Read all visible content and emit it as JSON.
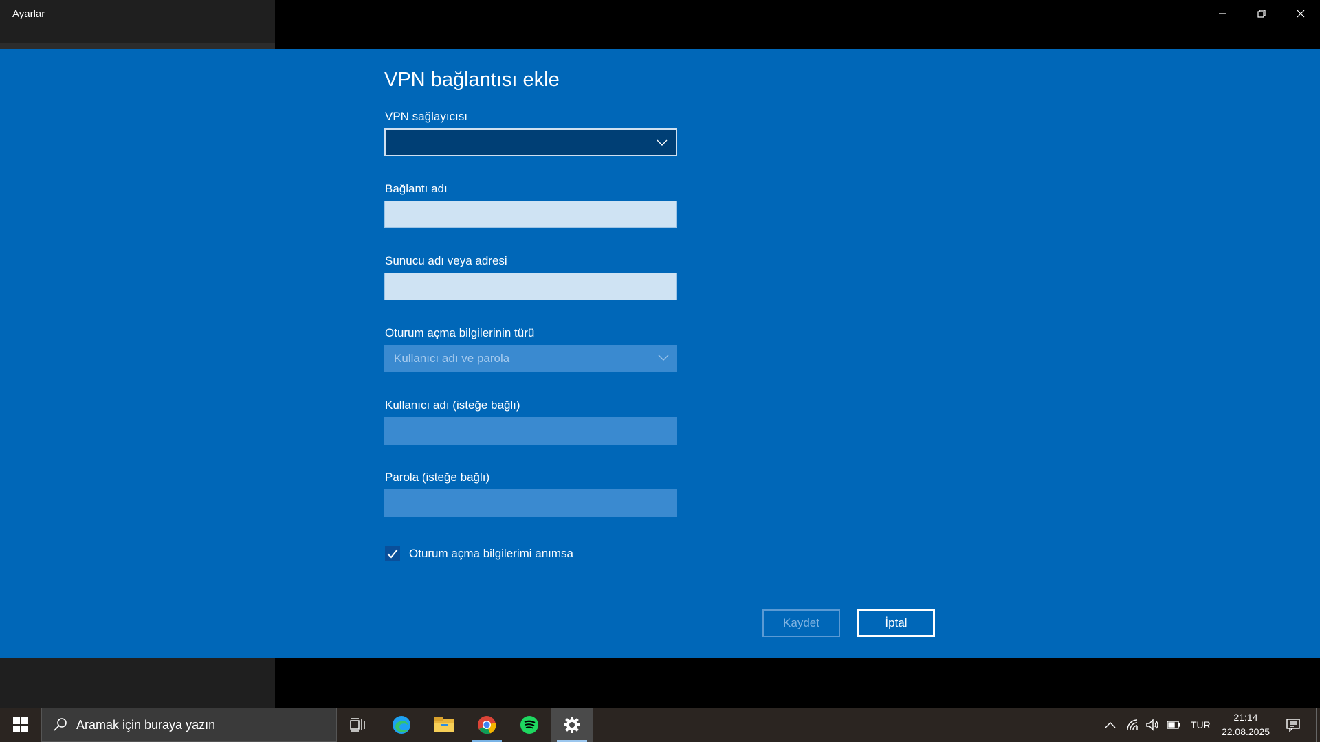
{
  "window": {
    "title": "Ayarlar",
    "minimize_icon": "minimize-icon",
    "restore_icon": "restore-icon",
    "close_icon": "close-icon"
  },
  "dialog": {
    "title": "VPN bağlantısı ekle",
    "provider_label": "VPN sağlayıcısı",
    "provider_value": "",
    "connection_name_label": "Bağlantı adı",
    "connection_name_value": "",
    "server_label": "Sunucu adı veya adresi",
    "server_value": "",
    "signin_type_label": "Oturum açma bilgilerinin türü",
    "signin_type_value": "Kullanıcı adı ve parola",
    "username_label": "Kullanıcı adı (isteğe bağlı)",
    "username_value": "",
    "password_label": "Parola (isteğe bağlı)",
    "password_value": "",
    "remember_label": "Oturum açma bilgilerimi anımsa",
    "remember_checked": true,
    "save_label": "Kaydet",
    "cancel_label": "İptal"
  },
  "taskbar": {
    "search_placeholder": "Aramak için buraya yazın",
    "apps": [
      "task-view-icon",
      "edge-icon",
      "file-explorer-icon",
      "chrome-icon",
      "spotify-icon",
      "settings-icon"
    ],
    "language": "TUR",
    "time": "21:14",
    "date": "22.08.2025"
  },
  "colors": {
    "dialog_bg": "#0067b8",
    "taskbar_bg": "#2b2521",
    "accent": "#0a4f9a"
  }
}
